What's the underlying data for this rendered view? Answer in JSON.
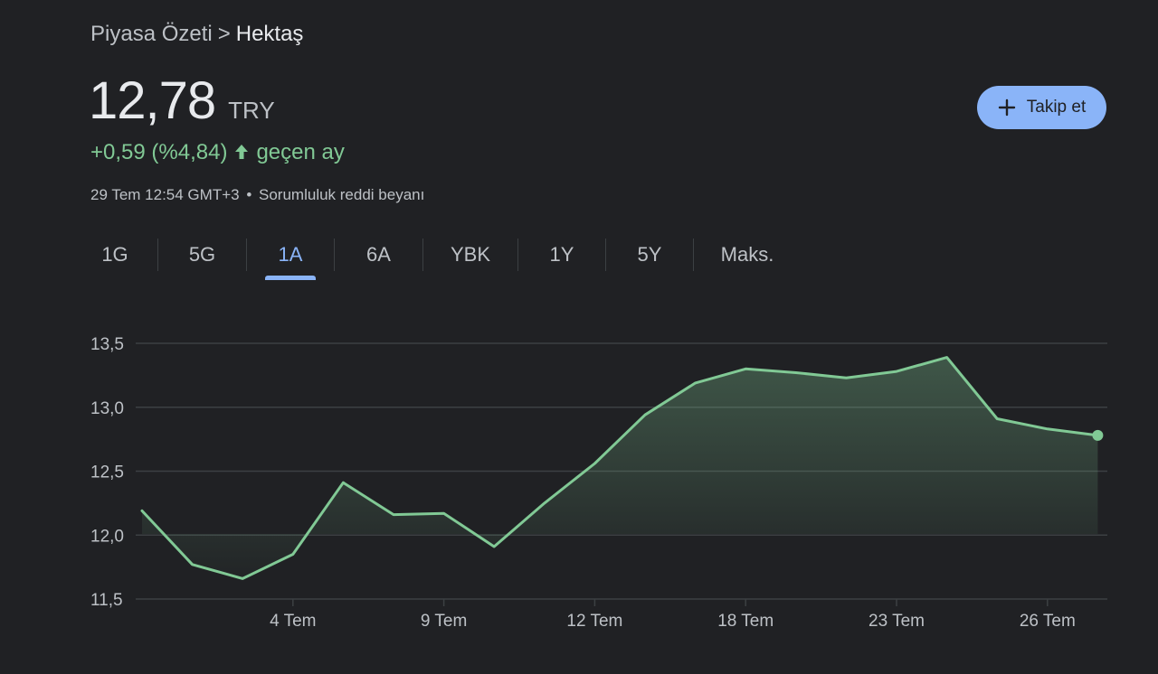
{
  "breadcrumb": {
    "parent": "Piyasa Özeti",
    "separator": ">",
    "current": "Hektaş"
  },
  "quote": {
    "price": "12,78",
    "currency": "TRY",
    "change": "+0,59 (%4,84)",
    "change_direction_icon": "arrow-up-icon",
    "change_period": "geçen ay",
    "timestamp": "29 Tem 12:54 GMT+3",
    "meta_separator": "•",
    "disclaimer": "Sorumluluk reddi beyanı"
  },
  "follow_button": {
    "label": "Takip et",
    "icon": "plus-icon"
  },
  "tabs": [
    {
      "label": "1G",
      "active": false
    },
    {
      "label": "5G",
      "active": false
    },
    {
      "label": "1A",
      "active": true
    },
    {
      "label": "6A",
      "active": false
    },
    {
      "label": "YBK",
      "active": false
    },
    {
      "label": "1Y",
      "active": false
    },
    {
      "label": "5Y",
      "active": false
    },
    {
      "label": "Maks.",
      "active": false
    }
  ],
  "colors": {
    "background": "#202124",
    "positive": "#81c995",
    "accent": "#8ab4f8",
    "gridline": "#3c4043",
    "text_secondary": "#bdc1c6"
  },
  "chart_data": {
    "type": "area",
    "x": [
      "1 Tem",
      "2 Tem",
      "3 Tem",
      "4 Tem",
      "5 Tem",
      "8 Tem",
      "9 Tem",
      "10 Tem",
      "11 Tem",
      "12 Tem",
      "15 Tem",
      "16 Tem",
      "17 Tem",
      "18 Tem",
      "19 Tem",
      "22 Tem",
      "23 Tem",
      "24 Tem",
      "25 Tem",
      "26 Tem",
      "29 Tem"
    ],
    "x_index": [
      0,
      1,
      2,
      3,
      4,
      5,
      6,
      7,
      8,
      9,
      10,
      11,
      12,
      13,
      14,
      15,
      16,
      17,
      18,
      19,
      20.4
    ],
    "values": [
      12.19,
      11.77,
      11.66,
      11.85,
      12.41,
      12.16,
      12.17,
      11.91,
      12.25,
      12.56,
      12.94,
      13.19,
      13.3,
      13.27,
      13.23,
      13.28,
      13.39,
      12.91,
      12.83,
      12.78
    ],
    "xticks": [
      {
        "label": "4 Tem",
        "index": 3
      },
      {
        "label": "9 Tem",
        "index": 6
      },
      {
        "label": "12 Tem",
        "index": 9
      },
      {
        "label": "18 Tem",
        "index": 12
      },
      {
        "label": "23 Tem",
        "index": 15
      },
      {
        "label": "26 Tem",
        "index": 18
      }
    ],
    "yticks": [
      {
        "value": 11.5,
        "label": "11,5"
      },
      {
        "value": 12.0,
        "label": "12,0"
      },
      {
        "value": 12.5,
        "label": "12,5"
      },
      {
        "value": 13.0,
        "label": "13,0"
      },
      {
        "value": 13.5,
        "label": "13,5"
      }
    ],
    "ylim": [
      11.5,
      13.5
    ],
    "grid": true,
    "line_color": "#81c995"
  }
}
